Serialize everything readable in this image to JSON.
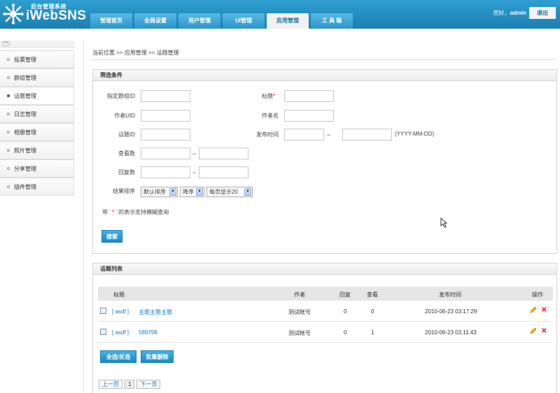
{
  "app": {
    "logo_subtitle": "后台管理系统",
    "logo_name": "iWebSNS"
  },
  "nav": {
    "tabs": [
      {
        "label": "管理首页",
        "active": false
      },
      {
        "label": "全局设置",
        "active": false
      },
      {
        "label": "用户管理",
        "active": false
      },
      {
        "label": "UI管理",
        "active": false
      },
      {
        "label": "应用管理",
        "active": true
      },
      {
        "label": "工 具 箱",
        "active": false
      }
    ]
  },
  "user": {
    "greeting": "您好，",
    "name": "admin",
    "logout_label": "退出"
  },
  "sidebar": {
    "collapse_label": "<<",
    "items": [
      {
        "label": "投票管理",
        "active": false
      },
      {
        "label": "群组管理",
        "active": false
      },
      {
        "label": "话题管理",
        "active": true
      },
      {
        "label": "日志管理",
        "active": false
      },
      {
        "label": "相册管理",
        "active": false
      },
      {
        "label": "照片管理",
        "active": false
      },
      {
        "label": "分享管理",
        "active": false
      },
      {
        "label": "插件管理",
        "active": false
      }
    ]
  },
  "breadcrumb": "当前位置 >> 应用管理 >> 话题管理",
  "filter": {
    "title": "筛选条件",
    "group_id_label": "指定群组ID",
    "title_label": "标题",
    "required_mark": "*",
    "author_uid_label": "作者UID",
    "author_name_label": "作者名",
    "topic_id_label": "话题ID",
    "publish_time_label": "发布时间",
    "tilde": "~",
    "date_hint": "(YYYY-MM-DD)",
    "views_label": "查看数",
    "replies_label": "回复数",
    "sort_label": "结果排序",
    "sort_select": "默认排序",
    "order_select": "降序",
    "pagesize_select": "每页显示20",
    "note_prefix": "带 ' ",
    "note_mark": "*",
    "note_suffix": " ' 的表示支持模糊查询",
    "search_label": "搜索"
  },
  "list": {
    "title": "话题列表",
    "columns": {
      "title": "标题",
      "author": "作者",
      "replies": "回复",
      "views": "查看",
      "time": "发布时间",
      "actions": "操作"
    },
    "rows": [
      {
        "group": "[ asdf ]",
        "title": "主题主题主题",
        "author": "测试帐号",
        "replies": "0",
        "views": "0",
        "time": "2010-06-23 03:17:29"
      },
      {
        "group": "[ asdf ]",
        "title": "589798",
        "author": "测试帐号",
        "replies": "0",
        "views": "1",
        "time": "2010-06-23 03:11:43"
      }
    ],
    "select_all_label": "全选/反选",
    "batch_delete_label": "批量删除",
    "pager": {
      "prev": "上一页",
      "current": "1",
      "next": "下一页"
    }
  },
  "colors": {
    "header": "#2394c8",
    "link": "#1a79bf",
    "button": "#2e9ed4"
  }
}
